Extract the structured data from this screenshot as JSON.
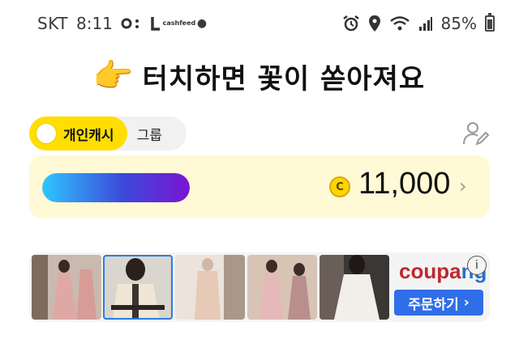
{
  "status_bar": {
    "carrier": "SKT",
    "time": "8:11",
    "app_badge_line1": "cash",
    "app_badge_line2": "feed",
    "battery": "85%",
    "icons": [
      "oo-icon",
      "l-icon",
      "cashfeed-icon",
      "dot-icon",
      "alarm-icon",
      "location-icon",
      "wifi-icon",
      "signal-icon",
      "battery-icon"
    ]
  },
  "headline": {
    "icon": "pointing-hand-icon",
    "text": "터치하면 꽃이 쏟아져요"
  },
  "toggle": {
    "active_label": "개인캐시",
    "inactive_label": "그룹"
  },
  "cash_card": {
    "progress": 1.0,
    "coin_symbol": "C",
    "amount": "11,000",
    "chevron": "›"
  },
  "ad": {
    "brand_part1": "coupa",
    "brand_part2": "ng",
    "info_symbol": "i",
    "button_label": "주문하기",
    "button_arrow": "›",
    "thumbnails": [
      "pink-floral-dress",
      "beige-jacket-outfit",
      "beige-blazer-set",
      "pink-skirt-outfit",
      "white-dress"
    ]
  },
  "colors": {
    "accent_yellow": "#ffde00",
    "card_bg": "#fff9d6",
    "coupang_blue": "#2f6ee8"
  }
}
